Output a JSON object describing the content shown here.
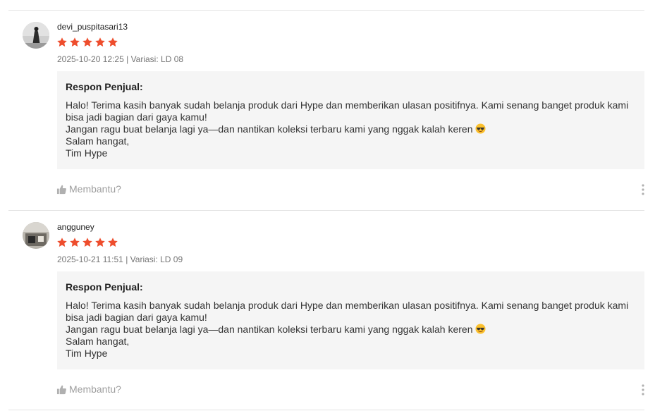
{
  "reviews": [
    {
      "username": "devi_puspitasari13",
      "rating": 5,
      "date": "2025-10-20 12:25",
      "separator": "|",
      "variant": "Variasi: LD 08",
      "response_title": "Respon Penjual:",
      "response_lines": [
        "Halo! Terima kasih banyak sudah belanja produk dari Hype dan memberikan ulasan positifnya. Kami senang banget produk kami",
        "bisa jadi bagian dari gaya kamu!",
        "Jangan ragu buat belanja lagi ya—dan nantikan koleksi terbaru kami yang nggak kalah keren",
        "Salam hangat,",
        "Tim Hype"
      ],
      "helpful_label": "Membantu?"
    },
    {
      "username": "angguney",
      "rating": 5,
      "date": "2025-10-21 11:51",
      "separator": "|",
      "variant": "Variasi: LD 09",
      "response_title": "Respon Penjual:",
      "response_lines": [
        "Halo! Terima kasih banyak sudah belanja produk dari Hype dan memberikan ulasan positifnya. Kami senang banget produk kami",
        "bisa jadi bagian dari gaya kamu!",
        "Jangan ragu buat belanja lagi ya—dan nantikan koleksi terbaru kami yang nggak kalah keren",
        "Salam hangat,",
        "Tim Hype"
      ],
      "helpful_label": "Membantu?"
    }
  ],
  "icons": {
    "star": "star-icon",
    "emoji": "sunglasses-emoji-icon",
    "thumb": "thumbs-up-icon",
    "more": "more-vertical-icon"
  },
  "colors": {
    "star": "#ee4d2d",
    "meta_text": "#757575",
    "response_bg": "#f5f5f5",
    "helpful_text": "#9e9e9e",
    "divider": "#e4e4e4"
  }
}
